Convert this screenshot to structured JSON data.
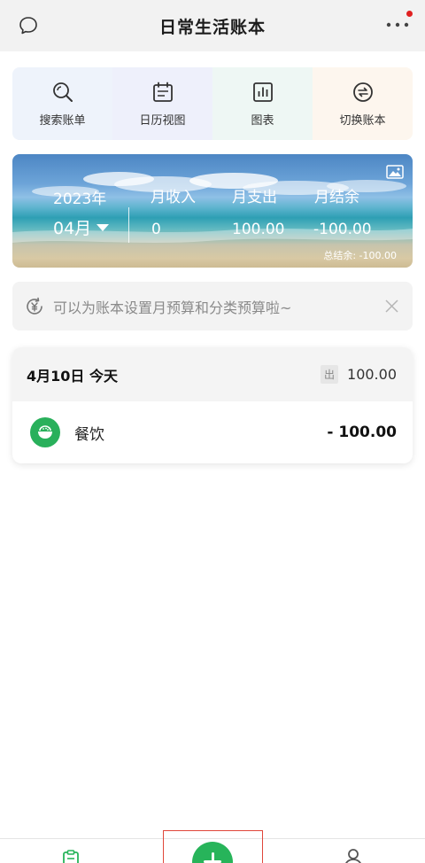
{
  "header": {
    "title": "日常生活账本",
    "left_icon": "chat-bubble-icon",
    "right_icon": "more-dots-icon"
  },
  "quick_actions": [
    {
      "label": "搜索账单",
      "icon": "search-icon"
    },
    {
      "label": "日历视图",
      "icon": "calendar-icon"
    },
    {
      "label": "图表",
      "icon": "bar-chart-icon"
    },
    {
      "label": "切换账本",
      "icon": "switch-icon"
    }
  ],
  "banner": {
    "year": "2023年",
    "month": "04月",
    "income_label": "月收入",
    "income_value": "0",
    "expense_label": "月支出",
    "expense_value": "100.00",
    "balance_label": "月结余",
    "balance_value": "-100.00",
    "total_balance": "总结余: -100.00",
    "image_icon": "image-icon"
  },
  "tip": {
    "text": "可以为账本设置月预算和分类预算啦~",
    "icon": "yen-refresh-icon",
    "close_icon": "close-icon"
  },
  "day_group": {
    "date": "4月10日 今天",
    "out_tag": "出",
    "out_total": "100.00",
    "entries": [
      {
        "category": "餐饮",
        "amount": "- 100.00",
        "icon": "rice-bowl-icon"
      }
    ]
  },
  "tabbar": {
    "left_icon": "clipboard-icon",
    "center_icon": "add-icon",
    "right_icon": "profile-icon"
  },
  "colors": {
    "accent": "#27b45a",
    "highlight_frame": "#e0463a",
    "notification_dot": "#e02020"
  }
}
